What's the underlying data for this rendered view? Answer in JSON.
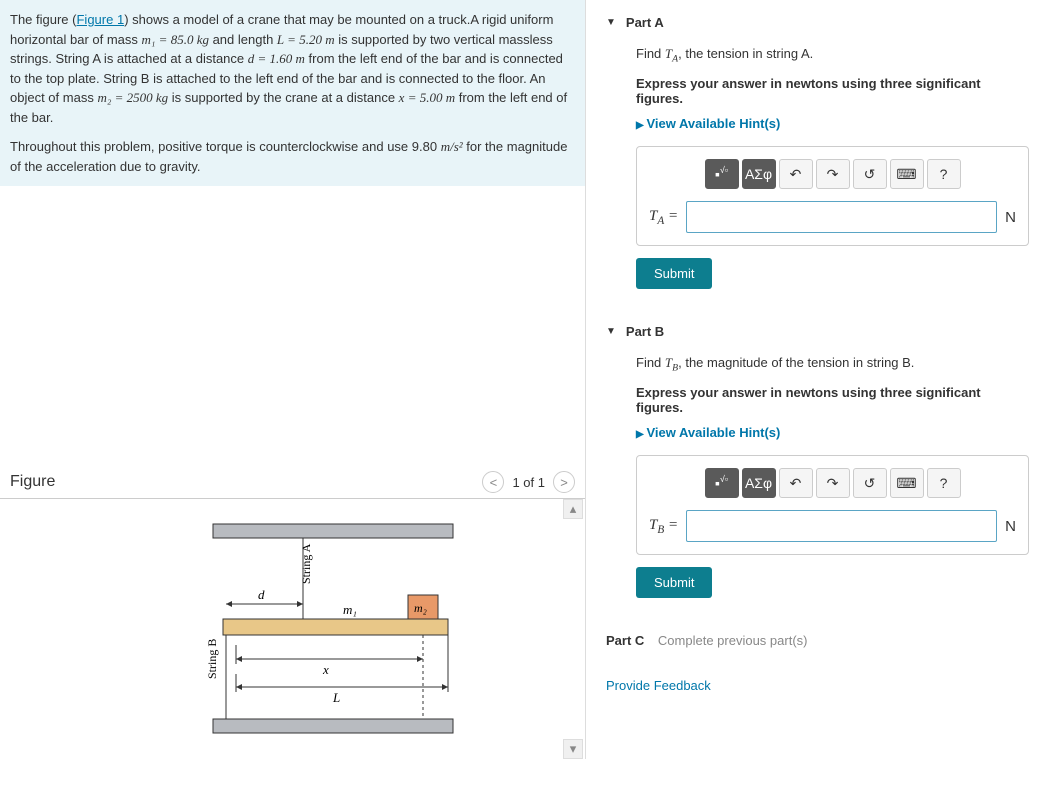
{
  "problem": {
    "p1a": "The figure (",
    "figlink": "Figure 1",
    "p1b": ") shows a model of a crane that may be mounted on a truck.A rigid uniform horizontal bar of mass ",
    "m1eq": "m₁ = 85.0 kg",
    "p1c": " and length ",
    "Leq": "L = 5.20 m",
    "p1d": " is supported by two vertical massless strings. String A is attached at a distance ",
    "deq": "d = 1.60 m",
    "p1e": " from the left end of the bar and is connected to the top plate. String B is attached to the left end of the bar and is connected to the floor. An object of mass ",
    "m2eq": "m₂ = 2500 kg",
    "p1f": " is supported by the crane at a distance ",
    "xeq": "x = 5.00 m",
    "p1g": " from the left end of the bar.",
    "p2a": "Throughout this problem, positive torque is counterclockwise and use 9.80 ",
    "grav": "m/s²",
    "p2b": " for the magnitude of the acceleration due to gravity."
  },
  "figure": {
    "title": "Figure",
    "nav": "1 of 1",
    "labels": {
      "stringA": "String A",
      "stringB": "String B",
      "d": "d",
      "m1": "m₁",
      "m2": "m₂",
      "x": "x",
      "L": "L"
    }
  },
  "partA": {
    "title": "Part A",
    "find_a": "Find ",
    "var": "T_A",
    "find_b": ", the tension in string A.",
    "express": "Express your answer in newtons using three significant figures.",
    "hints": "View Available Hint(s)",
    "label_pre": "T",
    "label_sub": "A",
    "eq": " = ",
    "unit": "N",
    "submit": "Submit"
  },
  "partB": {
    "title": "Part B",
    "find_a": "Find ",
    "var": "T_B",
    "find_b": ", the magnitude of the tension in string B.",
    "express": "Express your answer in newtons using three significant figures.",
    "hints": "View Available Hint(s)",
    "label_pre": "T",
    "label_sub": "B",
    "eq": " = ",
    "unit": "N",
    "submit": "Submit"
  },
  "partC": {
    "title": "Part C",
    "text": "Complete previous part(s)"
  },
  "toolbar": {
    "greek": "ΑΣφ",
    "help": "?"
  },
  "feedback": "Provide Feedback"
}
